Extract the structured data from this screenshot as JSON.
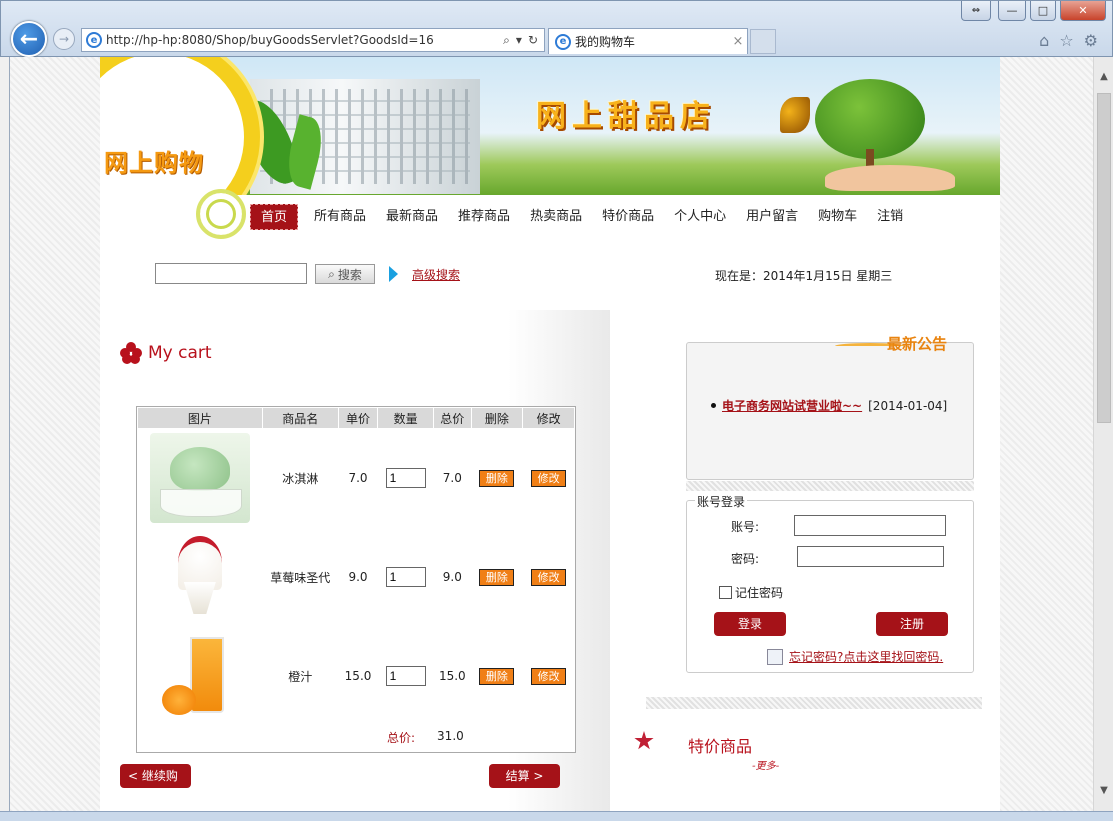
{
  "browser": {
    "url": "http://hp-hp:8080/Shop/buyGoodsServlet?GoodsId=16",
    "tab_title": "我的购物车"
  },
  "banner": {
    "circle_title": "网上购物",
    "shop_title": "网上甜品店"
  },
  "nav": {
    "items": [
      "首页",
      "所有商品",
      "最新商品",
      "推荐商品",
      "热卖商品",
      "特价商品",
      "个人中心",
      "用户留言",
      "购物车",
      "注销"
    ],
    "active": "首页"
  },
  "search": {
    "input_value": "",
    "button_label": "搜索",
    "advanced_label": "高级搜索"
  },
  "date_text": "现在是：2014年1月15日  星期三",
  "cart": {
    "title": "My cart",
    "columns": [
      "图片",
      "商品名",
      "单价",
      "数量",
      "总价",
      "删除",
      "修改"
    ],
    "rows": [
      {
        "name": "冰淇淋",
        "price": "7.0",
        "qty": "1",
        "total": "7.0",
        "delete_label": "删除",
        "edit_label": "修改"
      },
      {
        "name": "草莓味圣代",
        "price": "9.0",
        "qty": "1",
        "total": "9.0",
        "delete_label": "删除",
        "edit_label": "修改"
      },
      {
        "name": "橙汁",
        "price": "15.0",
        "qty": "1",
        "total": "15.0",
        "delete_label": "删除",
        "edit_label": "修改"
      }
    ],
    "total_label": "总价:",
    "total_value": "31.0",
    "continue_label": "< 继续购物",
    "checkout_label": "结算 >"
  },
  "notice": {
    "title": "最新公告",
    "items": [
      {
        "text": "电子商务网站试营业啦~~",
        "date": "[2014-01-04]"
      }
    ]
  },
  "login": {
    "legend": "账号登录",
    "account_label": "账号:",
    "password_label": "密码:",
    "remember_label": "记住密码",
    "login_button": "登录",
    "register_button": "注册",
    "forgot_link": "忘记密码?点击这里找回密码."
  },
  "special": {
    "title": "特价商品",
    "more": "-更多-"
  }
}
